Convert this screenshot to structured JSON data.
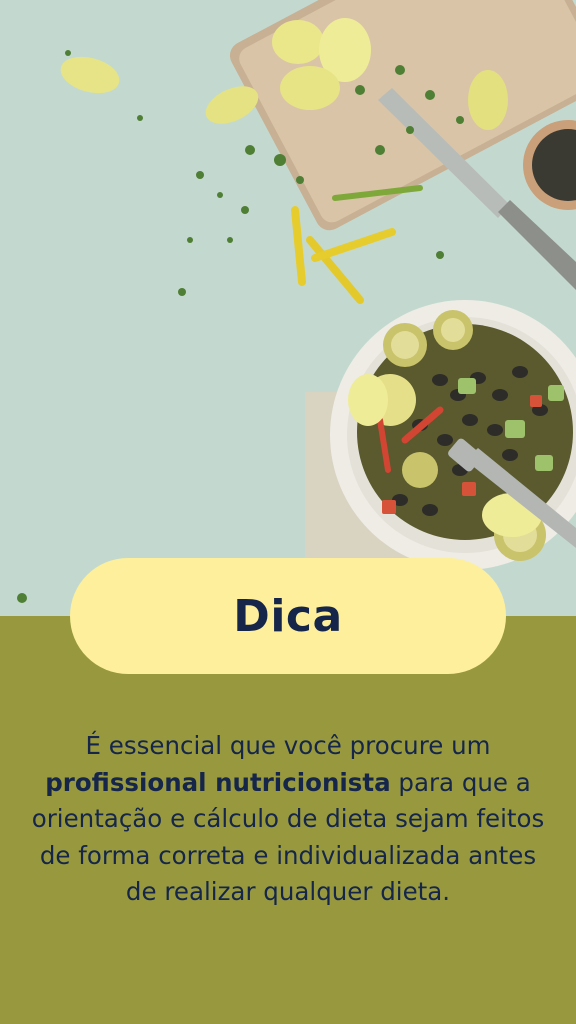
{
  "background": {
    "photo_description_icon": "food-photo",
    "accent_color": "#98993f",
    "pill_color": "#fdef9b",
    "text_color": "#15264a"
  },
  "card": {
    "title": "Dica",
    "text_before": "É essencial que você procure um ",
    "text_bold": "profissional nutricionista",
    "text_after": " para que a orientação e cálculo de dieta sejam feitos de forma correta e individualizada antes de realizar qualquer dieta."
  }
}
